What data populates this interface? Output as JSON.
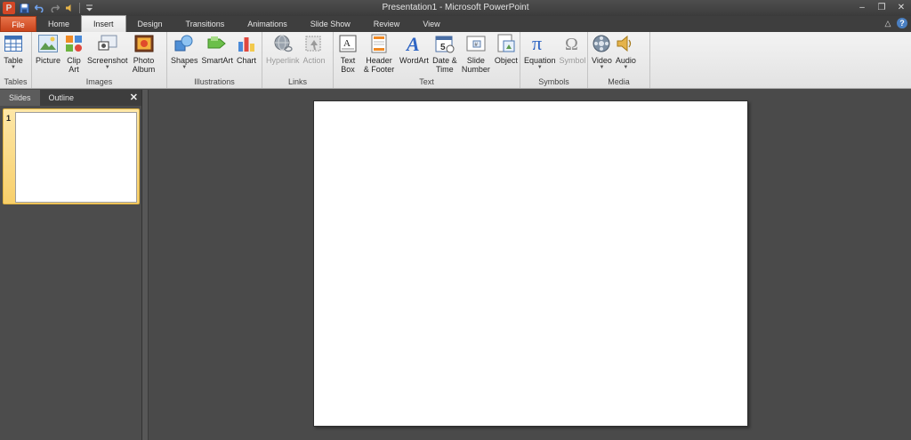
{
  "titlebar": {
    "app_icon_letter": "P",
    "title": "Presentation1  -  Microsoft PowerPoint",
    "qat_icons": [
      "save-icon",
      "undo-icon",
      "redo-icon",
      "audio-icon",
      "customize-qat-icon"
    ]
  },
  "tabs": {
    "file": "File",
    "items": [
      "Home",
      "Insert",
      "Design",
      "Transitions",
      "Animations",
      "Slide Show",
      "Review",
      "View"
    ],
    "active": "Insert"
  },
  "ribbon": {
    "groups": [
      {
        "label": "Tables",
        "buttons": [
          {
            "label": "Table",
            "dropdown": true
          }
        ]
      },
      {
        "label": "Images",
        "buttons": [
          {
            "label": "Picture"
          },
          {
            "label": "Clip Art"
          },
          {
            "label": "Screenshot",
            "dropdown": true
          },
          {
            "label": "Photo Album",
            "dropdown": true
          }
        ]
      },
      {
        "label": "Illustrations",
        "buttons": [
          {
            "label": "Shapes",
            "dropdown": true
          },
          {
            "label": "SmartArt"
          },
          {
            "label": "Chart"
          }
        ]
      },
      {
        "label": "Links",
        "buttons": [
          {
            "label": "Hyperlink",
            "disabled": true
          },
          {
            "label": "Action",
            "disabled": true
          }
        ]
      },
      {
        "label": "Text",
        "buttons": [
          {
            "label": "Text Box",
            "dropdown": true
          },
          {
            "label": "Header & Footer"
          },
          {
            "label": "WordArt",
            "dropdown": true
          },
          {
            "label": "Date & Time"
          },
          {
            "label": "Slide Number"
          },
          {
            "label": "Object"
          }
        ]
      },
      {
        "label": "Symbols",
        "buttons": [
          {
            "label": "Equation",
            "dropdown": true
          },
          {
            "label": "Symbol",
            "disabled": true
          }
        ]
      },
      {
        "label": "Media",
        "buttons": [
          {
            "label": "Video",
            "dropdown": true
          },
          {
            "label": "Audio",
            "dropdown": true
          }
        ]
      }
    ]
  },
  "panel": {
    "tabs": [
      "Slides",
      "Outline"
    ],
    "active_tab": "Slides",
    "slide_numbers": [
      "1"
    ]
  },
  "colors": {
    "file_tab": "#d24726",
    "selection": "#f8cf6a",
    "workspace": "#4a4a4a"
  }
}
